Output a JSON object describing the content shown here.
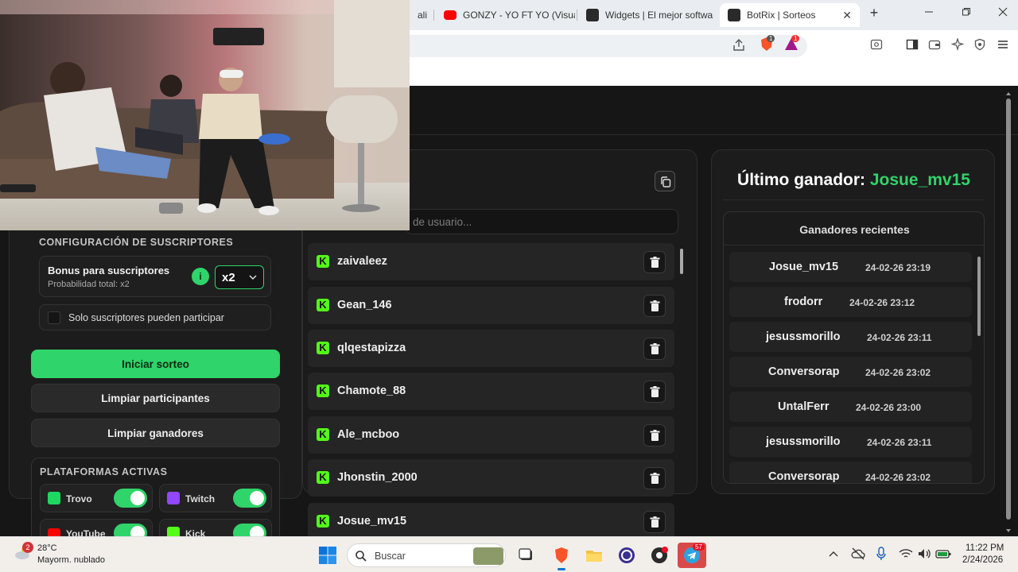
{
  "browser": {
    "tabs": [
      {
        "label": "ali"
      },
      {
        "label": "GONZY - YO FT YO (Visuali"
      },
      {
        "label": "Widgets | El mejor software"
      },
      {
        "label": "BotRix | Sorteos",
        "close": "✕"
      }
    ],
    "new_tab": "+",
    "badges": {
      "shield": "1",
      "alert": "1"
    }
  },
  "config": {
    "subs_title": "CONFIGURACIÓN DE SUSCRIPTORES",
    "bonus_label": "Bonus para suscriptores",
    "bonus_sub": "Probabilidad total: x2",
    "bonus_info": "i",
    "bonus_value": "x2",
    "subs_only_label": "Solo suscriptores pueden participar",
    "start_button": "Iniciar sorteo",
    "clear_participants_button": "Limpiar participantes",
    "clear_winners_button": "Limpiar ganadores",
    "platforms_title": "PLATAFORMAS ACTIVAS",
    "platforms": [
      {
        "name": "Trovo",
        "color": "#1ed760",
        "on": true
      },
      {
        "name": "Twitch",
        "color": "#9146ff",
        "on": true
      },
      {
        "name": "YouTube",
        "color": "#ff0000",
        "on": true
      },
      {
        "name": "Kick",
        "color": "#53fc18",
        "on": true
      }
    ]
  },
  "participants": {
    "search_placeholder": "de usuario...",
    "items": [
      {
        "name": "zaivaleez"
      },
      {
        "name": "Gean_146"
      },
      {
        "name": "qlqestapizza"
      },
      {
        "name": "Chamote_88"
      },
      {
        "name": "Ale_mcboo"
      },
      {
        "name": "Jhonstin_2000"
      },
      {
        "name": "Josue_mv15"
      }
    ]
  },
  "winners": {
    "last_winner_label": "Último ganador:",
    "last_winner_name": "Josue_mv15",
    "recent_title": "Ganadores recientes",
    "items": [
      {
        "name": "Josue_mv15",
        "date": "24-02-26 23:19"
      },
      {
        "name": "frodorr",
        "date": "24-02-26 23:12"
      },
      {
        "name": "jesussmorillo",
        "date": "24-02-26 23:11"
      },
      {
        "name": "Conversorap",
        "date": "24-02-26 23:02"
      },
      {
        "name": "UntalFerr",
        "date": "24-02-26 23:00"
      },
      {
        "name": "jesussmorillo",
        "date": "24-02-26 23:11"
      },
      {
        "name": "Conversorap",
        "date": "24-02-26 23:02"
      }
    ]
  },
  "taskbar": {
    "weather_temp": "28°C",
    "weather_desc": "Mayorm. nublado",
    "weather_badge": "2",
    "search_placeholder": "Buscar",
    "telegram_badge": "57",
    "time": "11:22 PM",
    "date": "2/24/2026"
  }
}
